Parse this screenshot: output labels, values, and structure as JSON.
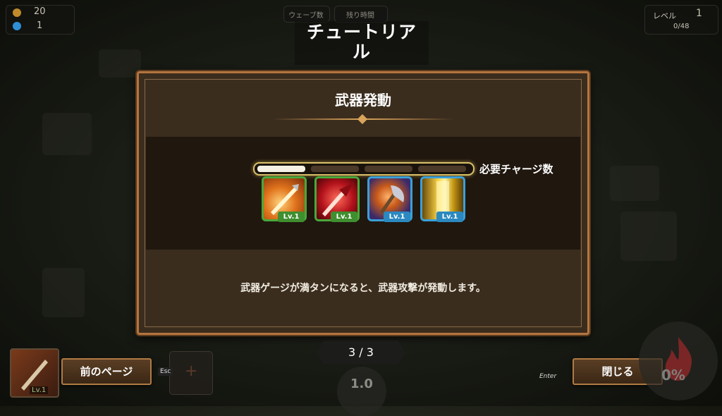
{
  "hud": {
    "coins": "20",
    "gems": "1",
    "wave_label": "ウェーブ数",
    "time_label": "残り時間",
    "level_label": "レベル",
    "level_value": "1",
    "exp_value": "0/48"
  },
  "tutorial": {
    "title_line1": "チュートリア",
    "title_line2": "ル",
    "heading": "武器発動",
    "charge_label": "必要チャージ数",
    "description": "武器ゲージが満タンになると、武器攻撃が発動します。",
    "gauge_filled_segments": 1,
    "gauge_total_segments": 4,
    "weapons": [
      {
        "name": "spear-weapon-icon",
        "level": "Lv.1",
        "frame": "green"
      },
      {
        "name": "arrowhead-weapon-icon",
        "level": "Lv.1",
        "frame": "green"
      },
      {
        "name": "axe-weapon-icon",
        "level": "Lv.1",
        "frame": "blue"
      },
      {
        "name": "light-pillar-weapon-icon",
        "level": "Lv.1",
        "frame": "blue"
      }
    ]
  },
  "footer": {
    "page_indicator": "3 / 3",
    "prev_button": "前のページ",
    "prev_key": "Esc",
    "close_button": "閉じる",
    "close_key": "Enter",
    "skill_level": "Lv.1",
    "speed_value": "1.0",
    "percent_value": "0%"
  },
  "colors": {
    "panel_border": "#b4753f",
    "gauge_border": "#d8c06a",
    "frame_green": "#49a83a",
    "frame_blue": "#3aa0d8"
  }
}
